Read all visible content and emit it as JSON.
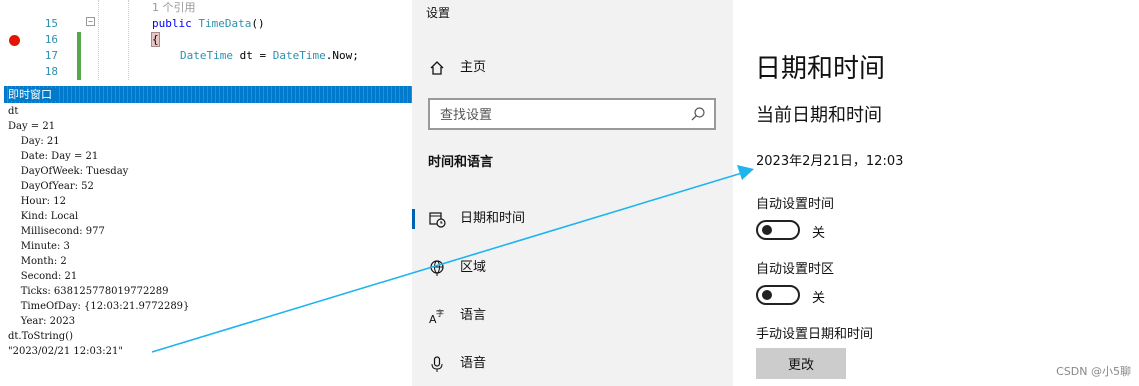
{
  "editor": {
    "codelens": "1 个引用",
    "lines": [
      {
        "number": "15",
        "keyword": "public",
        "type": "TimeData",
        "rest": "()"
      },
      {
        "number": "16",
        "brace": "{"
      },
      {
        "number": "17",
        "type1": "DateTime",
        "var": "dt",
        "op": " = ",
        "type2": "DateTime",
        "rest": ".Now;"
      },
      {
        "number": "18"
      }
    ]
  },
  "immediate": {
    "title": "即时窗口",
    "lines": [
      "dt",
      "Day = 21",
      "    Day: 21",
      "    Date: Day = 21",
      "    DayOfWeek: Tuesday",
      "    DayOfYear: 52",
      "    Hour: 12",
      "    Kind: Local",
      "    Millisecond: 977",
      "    Minute: 3",
      "    Month: 2",
      "    Second: 21",
      "    Ticks: 638125778019772289",
      "    TimeOfDay: {12:03:21.9772289}",
      "    Year: 2023",
      "dt.ToString()",
      "\"2023/02/21 12:03:21\""
    ]
  },
  "settings": {
    "title": "设置",
    "home": {
      "label": "主页",
      "icon": "home-icon"
    },
    "search": {
      "placeholder": "查找设置",
      "icon": "search-icon"
    },
    "section": "时间和语言",
    "nav": [
      {
        "label": "日期和时间",
        "icon": "calendar-clock-icon",
        "selected": true
      },
      {
        "label": "区域",
        "icon": "globe-icon",
        "selected": false
      },
      {
        "label": "语言",
        "icon": "language-icon",
        "selected": false
      },
      {
        "label": "语音",
        "icon": "microphone-icon",
        "selected": false
      }
    ],
    "accent_color": "#0063b1"
  },
  "datetime_page": {
    "title": "日期和时间",
    "subtitle": "当前日期和时间",
    "current": "2023年2月21日，12:03",
    "auto_time": {
      "label": "自动设置时间",
      "state": "关"
    },
    "auto_timezone": {
      "label": "自动设置时区",
      "state": "关"
    },
    "manual": {
      "label": "手动设置日期和时间",
      "button": "更改"
    }
  },
  "watermark": "CSDN @小5聊",
  "annotation_color": "#1eb4f0"
}
